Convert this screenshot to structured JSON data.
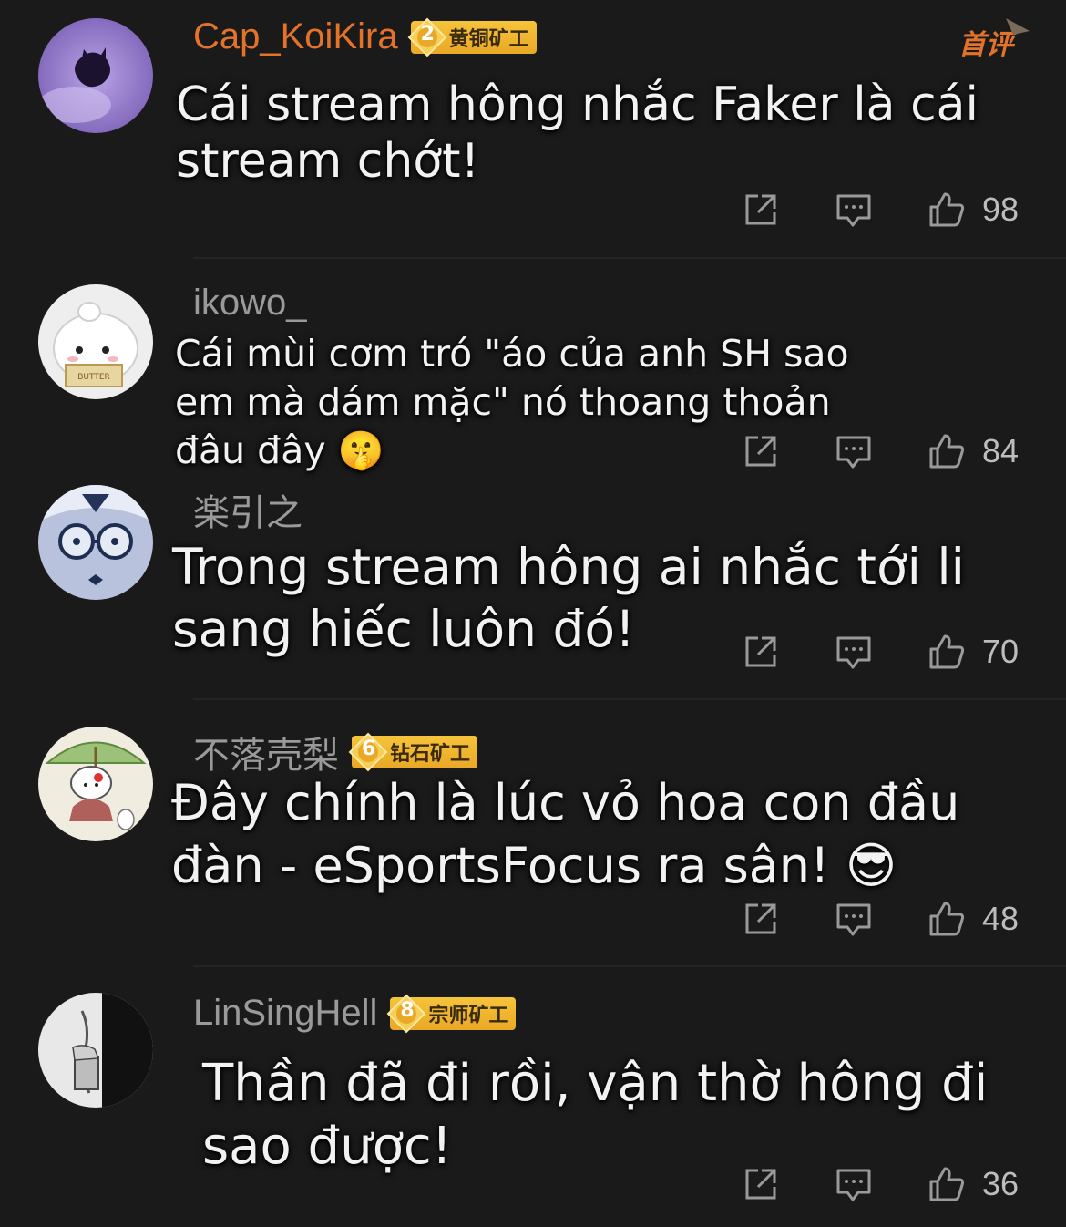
{
  "hot_tag": "首评",
  "comments": [
    {
      "username": "Cap_KoiKira",
      "badge_level": "2",
      "badge_label": "黄铜矿工",
      "text_line1": "Cái stream hông nhắc Faker là cái",
      "text_line2": "stream chớt!",
      "text_line3": "",
      "likes": "98"
    },
    {
      "username": "ikowo_",
      "text_line1": "Cái mùi cơm tró \"áo của anh SH sao",
      "text_line2": "em mà dám mặc\" nó thoang thoản",
      "text_line3": "đâu đây 🤫",
      "likes": "84"
    },
    {
      "username": "楽引之",
      "text_line1": "Trong stream hông ai nhắc tới li",
      "text_line2": "sang hiếc luôn đó!",
      "likes": "70"
    },
    {
      "username": "不落壳梨",
      "badge_level": "6",
      "badge_label": "钻石矿工",
      "text_line1": "Đây chính là lúc vỏ hoa con đầu",
      "text_line2": "đàn - eSportsFocus ra sân! 😎",
      "likes": "48"
    },
    {
      "username": "LinSingHell",
      "badge_level": "8",
      "badge_label": "宗师矿工",
      "text_line1": "Thần đã đi rồi, vận thờ hông đi",
      "text_line2": "sao được!",
      "likes": "36"
    }
  ],
  "avatar_text": {
    "butter": "BUTTER"
  },
  "icons": {
    "share": "share-icon",
    "reply": "reply-icon",
    "like": "thumbs-up-icon",
    "badge_gem": "diamond-gem-icon"
  },
  "colors": {
    "background": "#1a1a1a",
    "username_orange": "#e3722a",
    "username_gray": "#9a9a9a",
    "badge_gold": "#f2b936"
  }
}
